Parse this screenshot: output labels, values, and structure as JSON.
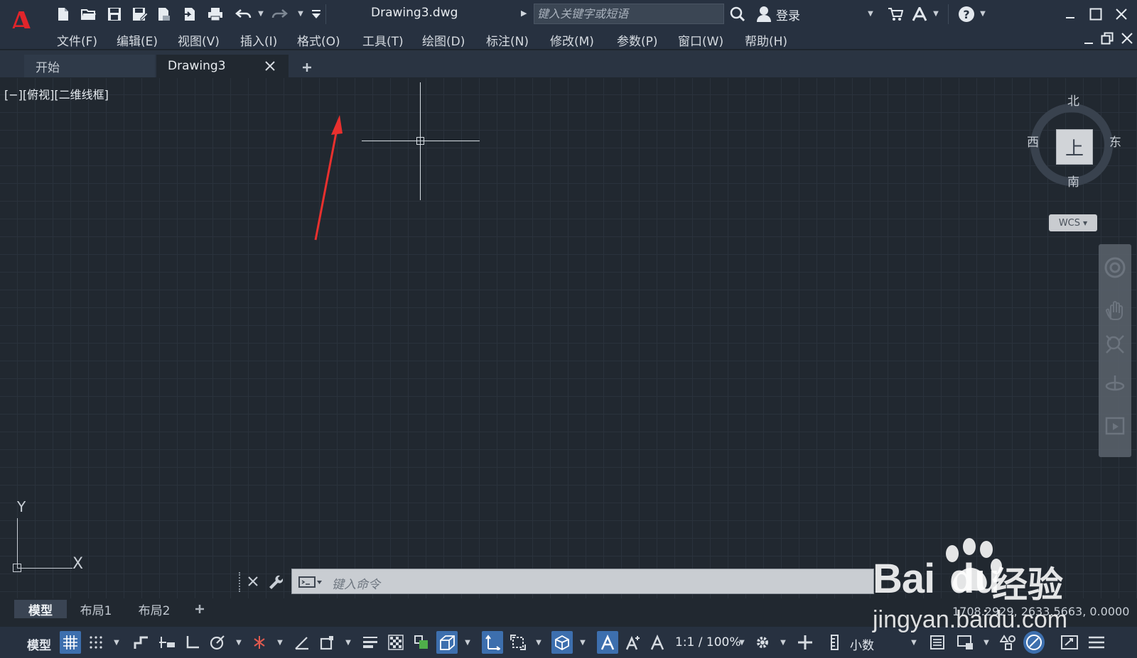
{
  "app": {
    "logo": "A",
    "document_title": "Drawing3.dwg",
    "search_placeholder": "键入关键字或短语",
    "login_label": "登录"
  },
  "menu": [
    {
      "label": "文件(F)"
    },
    {
      "label": "编辑(E)"
    },
    {
      "label": "视图(V)"
    },
    {
      "label": "插入(I)"
    },
    {
      "label": "格式(O)"
    },
    {
      "label": "工具(T)"
    },
    {
      "label": "绘图(D)"
    },
    {
      "label": "标注(N)"
    },
    {
      "label": "修改(M)"
    },
    {
      "label": "参数(P)"
    },
    {
      "label": "窗口(W)"
    },
    {
      "label": "帮助(H)"
    }
  ],
  "tabs": {
    "start_label": "开始",
    "active_label": "Drawing3"
  },
  "viewport": {
    "label": "[−][俯视][二维线框]",
    "ucs_x": "X",
    "ucs_y": "Y"
  },
  "viewcube": {
    "north": "北",
    "south": "南",
    "west": "西",
    "east": "东",
    "face": "上",
    "wcs": "WCS"
  },
  "command": {
    "placeholder": "键入命令"
  },
  "layout_tabs": {
    "model": "模型",
    "layout1": "布局1",
    "layout2": "布局2"
  },
  "coordinates": "1708.2929, 2633.5663, 0.0000",
  "status": {
    "model_label": "模型",
    "scale_label": "1:1 / 100%",
    "units_label": "小数"
  },
  "watermark": {
    "brand_bai": "Bai",
    "brand_du": "du",
    "brand_jy": "经验",
    "url": "jingyan.baidu.com"
  },
  "colors": {
    "background": "#212830",
    "logo_red": "#e0252b",
    "annotation_arrow": "#e8302e",
    "toggle_on": "#3d6fae"
  }
}
